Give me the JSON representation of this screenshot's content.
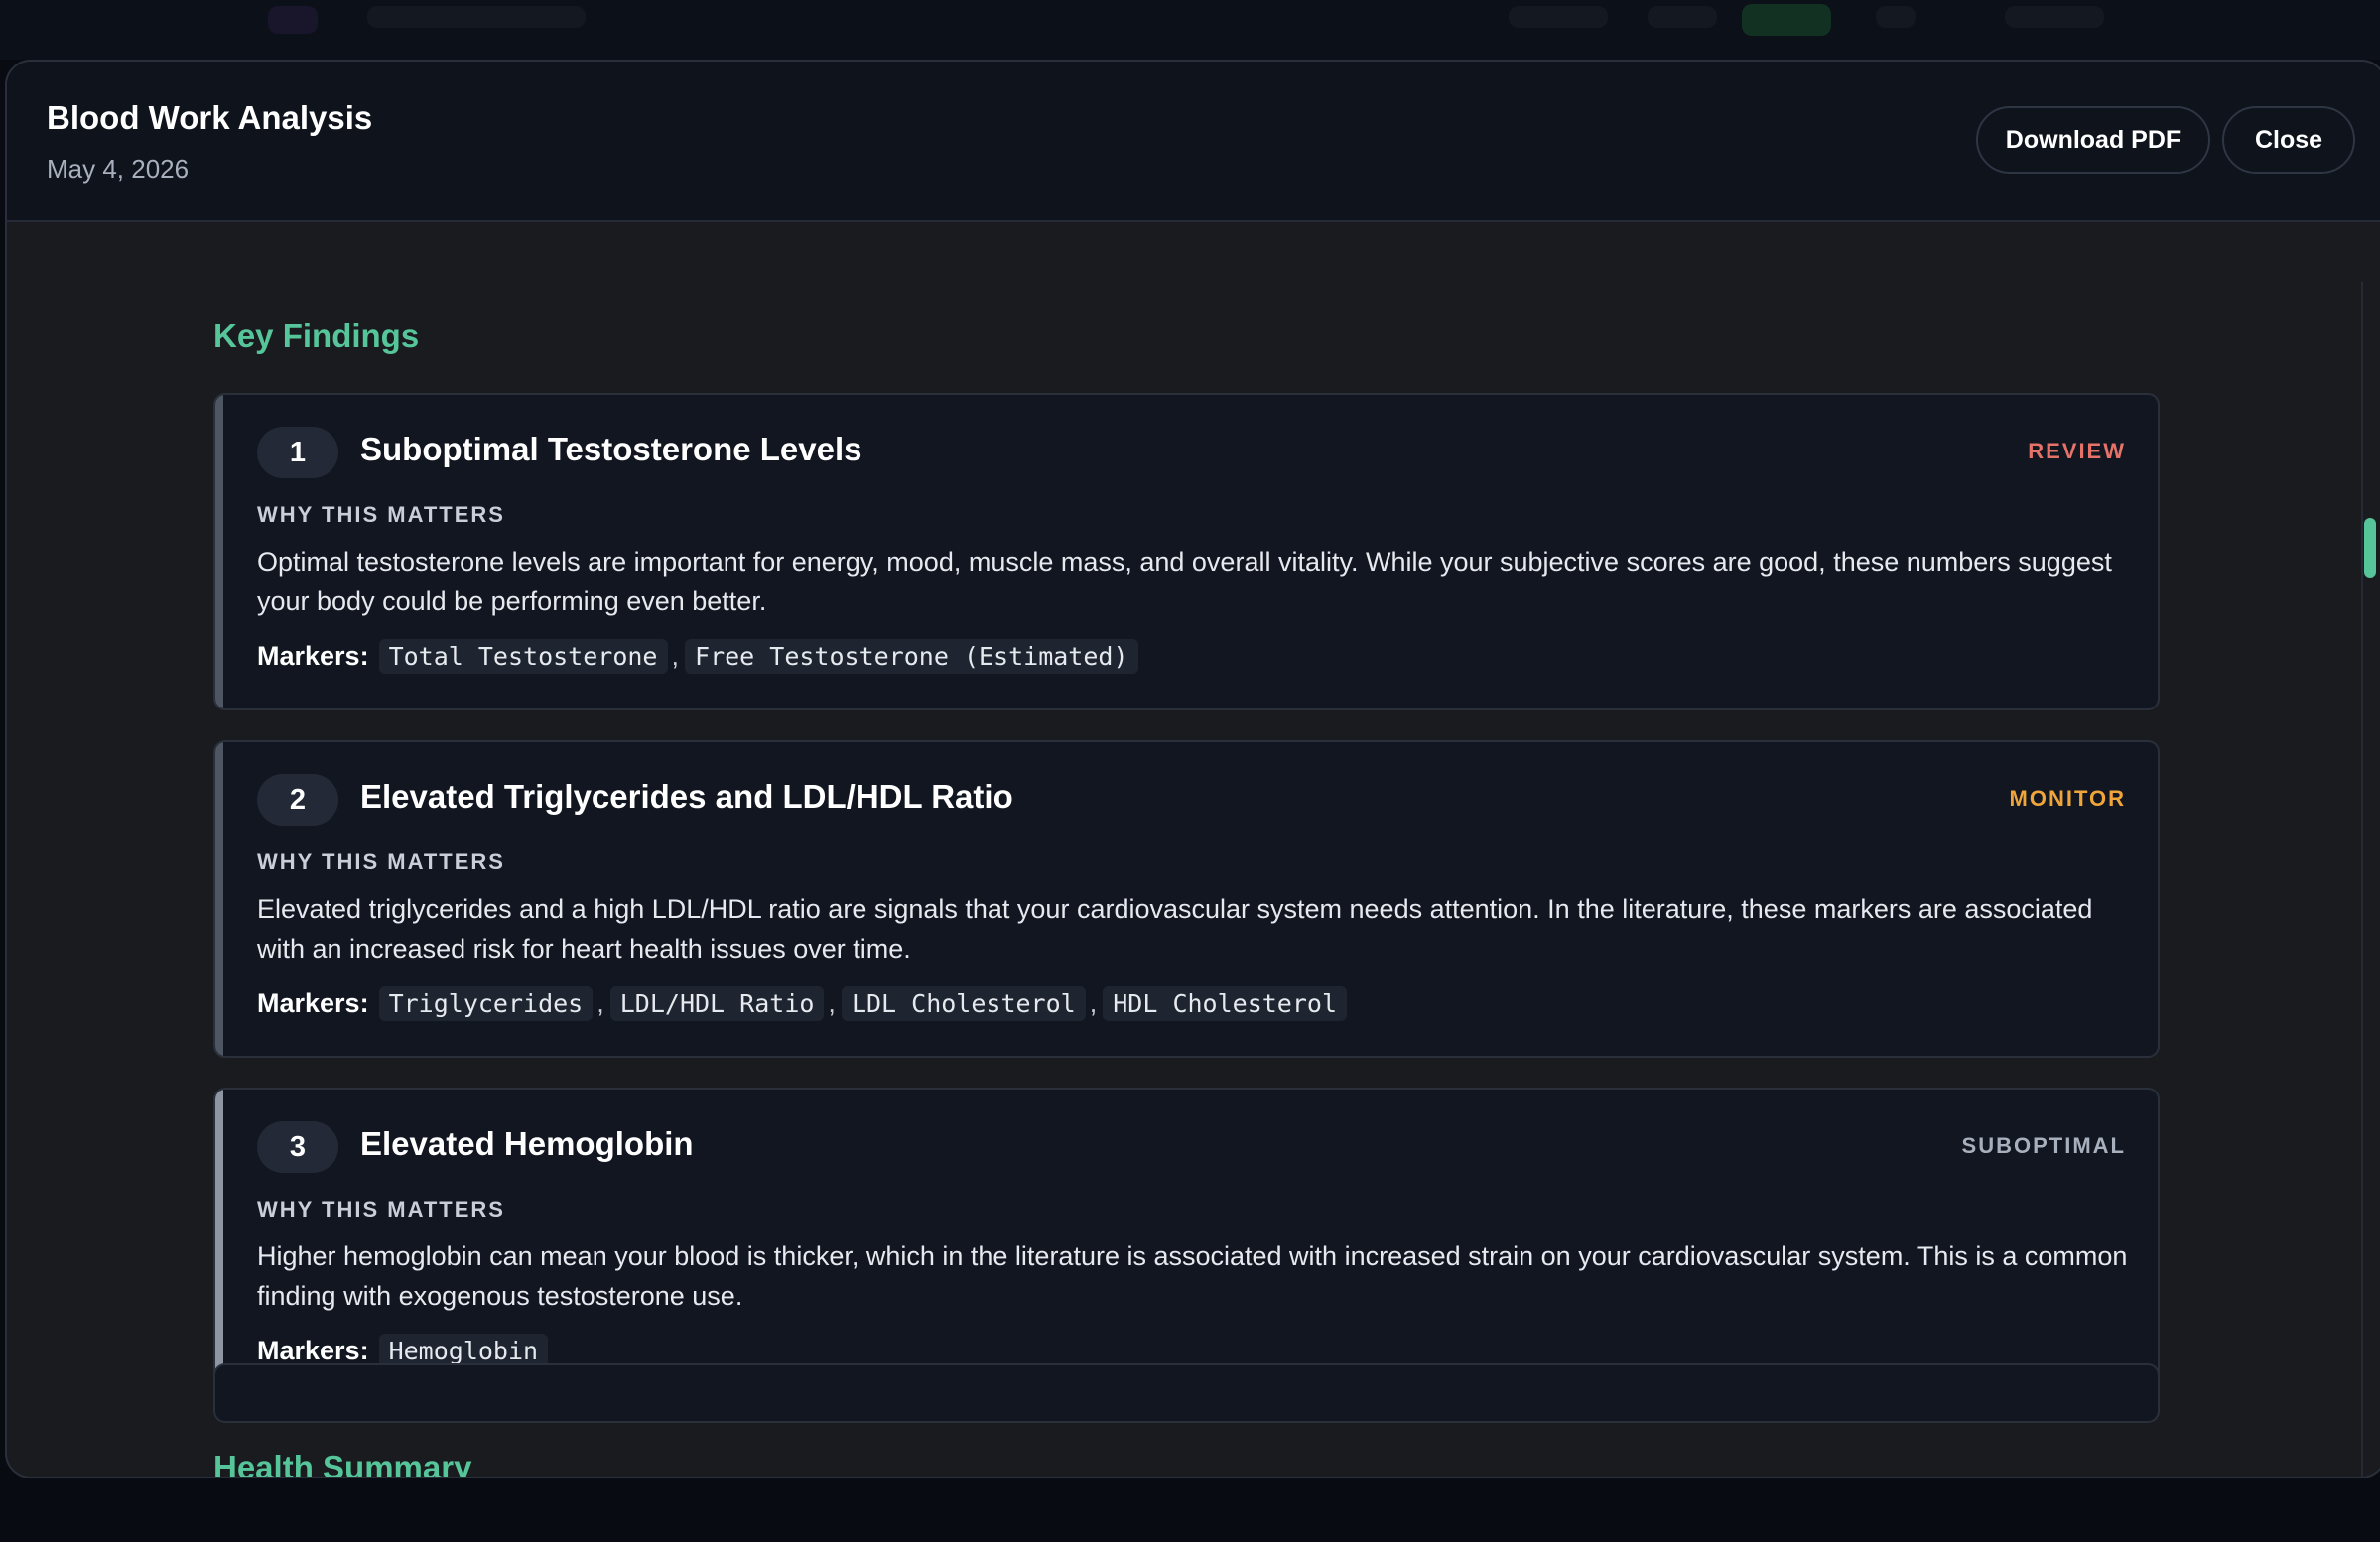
{
  "modal": {
    "title": "Blood Work Analysis",
    "date": "May 4, 2026",
    "download_label": "Download PDF",
    "close_label": "Close"
  },
  "sections": {
    "key_findings_title": "Key Findings",
    "health_summary_title": "Health Summary"
  },
  "findings": [
    {
      "number": "1",
      "title": "Suboptimal Testosterone Levels",
      "status": "REVIEW",
      "status_color": "#e5736a",
      "why_label": "WHY THIS MATTERS",
      "description": "Optimal testosterone levels are important for energy, mood, muscle mass, and overall vitality. While your subjective scores are good, these numbers suggest your body could be performing even better.",
      "markers_label": "Markers:",
      "markers": [
        "Total Testosterone",
        "Free Testosterone (Estimated)"
      ]
    },
    {
      "number": "2",
      "title": "Elevated Triglycerides and LDL/HDL Ratio",
      "status": "MONITOR",
      "status_color": "#f0a53a",
      "why_label": "WHY THIS MATTERS",
      "description": "Elevated triglycerides and a high LDL/HDL ratio are signals that your cardiovascular system needs attention. In the literature, these markers are associated with an increased risk for heart health issues over time.",
      "markers_label": "Markers:",
      "markers": [
        "Triglycerides",
        "LDL/HDL Ratio",
        "LDL Cholesterol",
        "HDL Cholesterol"
      ]
    },
    {
      "number": "3",
      "title": "Elevated Hemoglobin",
      "status": "SUBOPTIMAL",
      "status_color": "#a9b0bd",
      "why_label": "WHY THIS MATTERS",
      "description": "Higher hemoglobin can mean your blood is thicker, which in the literature is associated with increased strain on your cardiovascular system. This is a common finding with exogenous testosterone use.",
      "markers_label": "Markers:",
      "markers": [
        "Hemoglobin"
      ]
    }
  ],
  "colors": {
    "accent_green": "#56c59a",
    "modal_bg": "#191b1f",
    "card_bg": "#111620"
  }
}
